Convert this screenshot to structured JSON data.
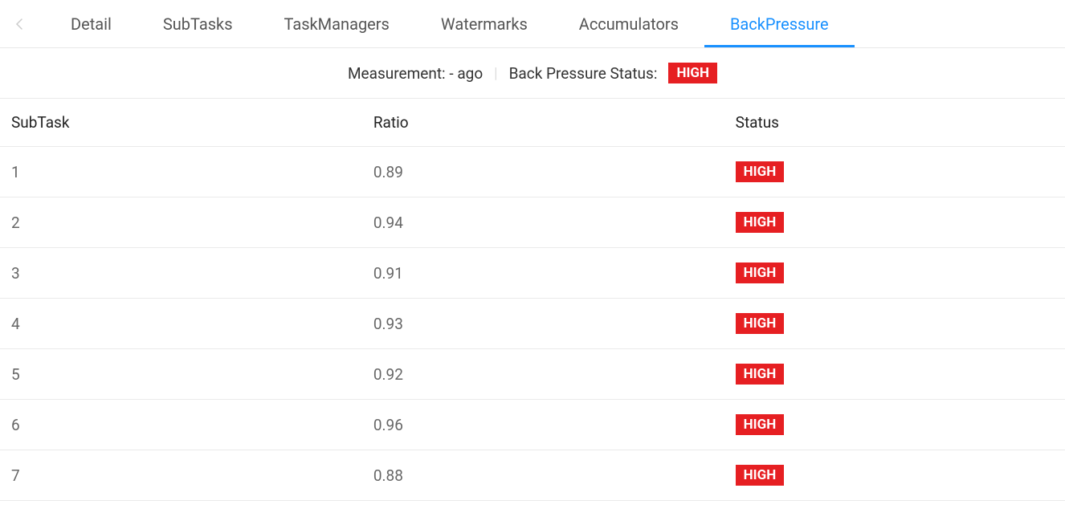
{
  "tabs": [
    {
      "label": "Detail",
      "active": false
    },
    {
      "label": "SubTasks",
      "active": false
    },
    {
      "label": "TaskManagers",
      "active": false
    },
    {
      "label": "Watermarks",
      "active": false
    },
    {
      "label": "Accumulators",
      "active": false
    },
    {
      "label": "BackPressure",
      "active": true
    }
  ],
  "summary": {
    "measurement_label": "Measurement:",
    "measurement_value": "- ago",
    "status_label": "Back Pressure Status:",
    "status_value": "HIGH"
  },
  "table": {
    "headers": {
      "subtask": "SubTask",
      "ratio": "Ratio",
      "status": "Status"
    },
    "rows": [
      {
        "subtask": "1",
        "ratio": "0.89",
        "status": "HIGH"
      },
      {
        "subtask": "2",
        "ratio": "0.94",
        "status": "HIGH"
      },
      {
        "subtask": "3",
        "ratio": "0.91",
        "status": "HIGH"
      },
      {
        "subtask": "4",
        "ratio": "0.93",
        "status": "HIGH"
      },
      {
        "subtask": "5",
        "ratio": "0.92",
        "status": "HIGH"
      },
      {
        "subtask": "6",
        "ratio": "0.96",
        "status": "HIGH"
      },
      {
        "subtask": "7",
        "ratio": "0.88",
        "status": "HIGH"
      }
    ]
  }
}
